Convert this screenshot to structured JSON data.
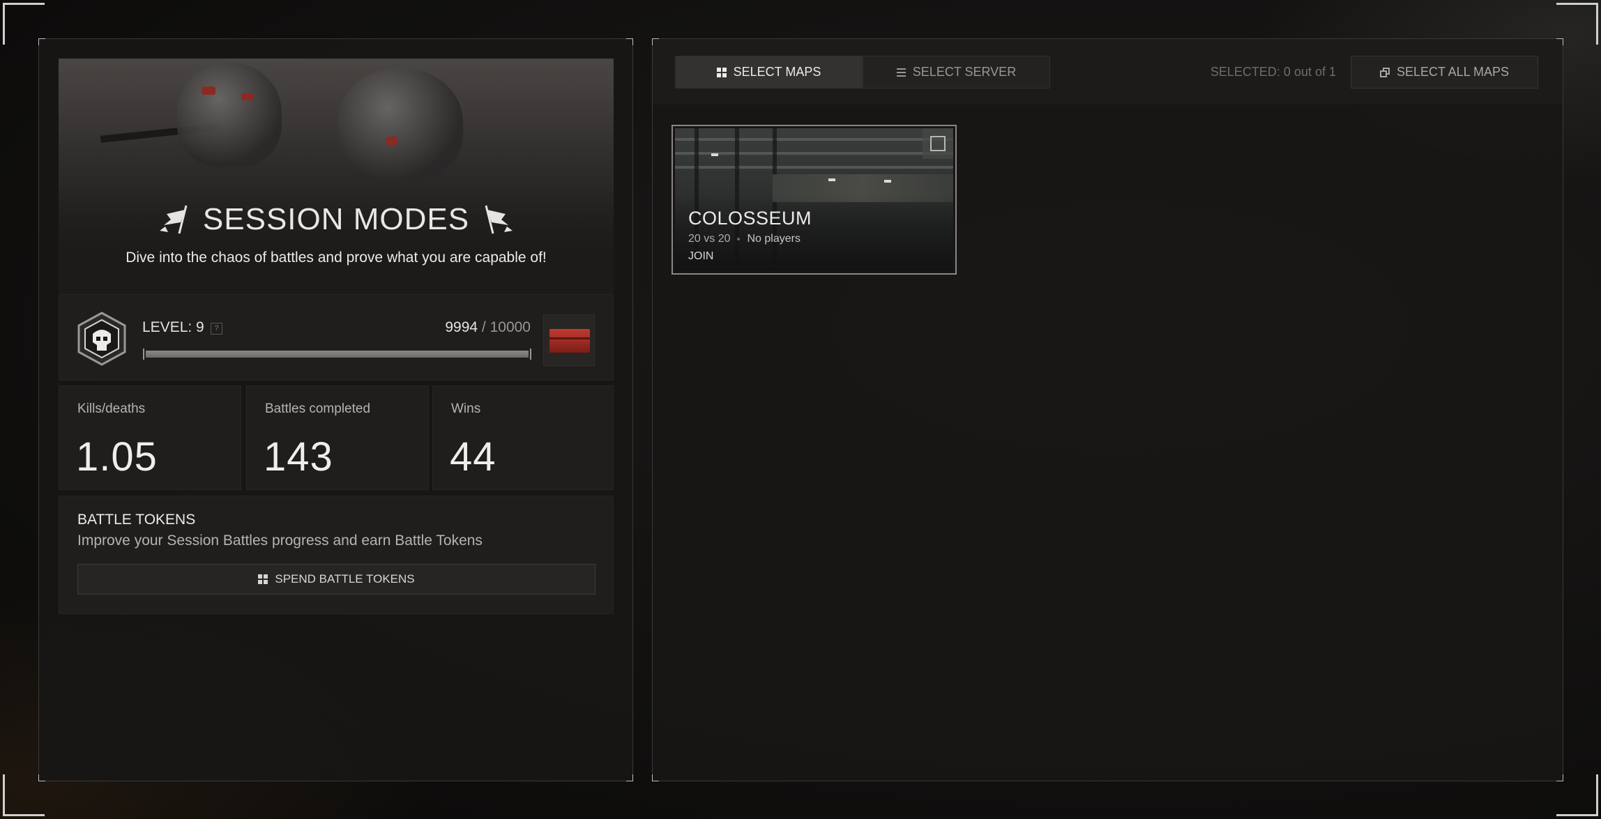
{
  "hero": {
    "title": "SESSION MODES",
    "subtitle": "Dive into the chaos of battles and prove what you are capable of!"
  },
  "level": {
    "label": "LEVEL: 9",
    "help": "?",
    "xp_current": "9994",
    "xp_max": "/ 10000",
    "progress_fraction": 0.9994
  },
  "stats": [
    {
      "label": "Kills/deaths",
      "value": "1.05"
    },
    {
      "label": "Battles completed",
      "value": "143"
    },
    {
      "label": "Wins",
      "value": "44"
    }
  ],
  "tokens": {
    "title": "BATTLE TOKENS",
    "description": "Improve your Session Battles progress and earn Battle Tokens",
    "button_label": "SPEND BATTLE TOKENS"
  },
  "topbar": {
    "tabs": [
      {
        "label": "SELECT MAPS",
        "active": true
      },
      {
        "label": "SELECT SERVER",
        "active": false
      }
    ],
    "selected_text": "SELECTED: 0 out of 1",
    "select_all_label": "SELECT ALL MAPS"
  },
  "maps": [
    {
      "name": "COLOSSEUM",
      "mode": "20 vs 20",
      "players": "No players",
      "action": "JOIN",
      "checked": false
    }
  ],
  "colors": {
    "accent_red": "#c23a30",
    "panel_bg": "#1f1e1d",
    "text_primary": "#ecebe8",
    "text_muted": "#b6b4b0"
  },
  "icons": [
    "flag-icon",
    "skull-emblem-icon",
    "crate-icon",
    "grid-icon",
    "list-icon",
    "stack-icon",
    "checkbox-icon"
  ]
}
